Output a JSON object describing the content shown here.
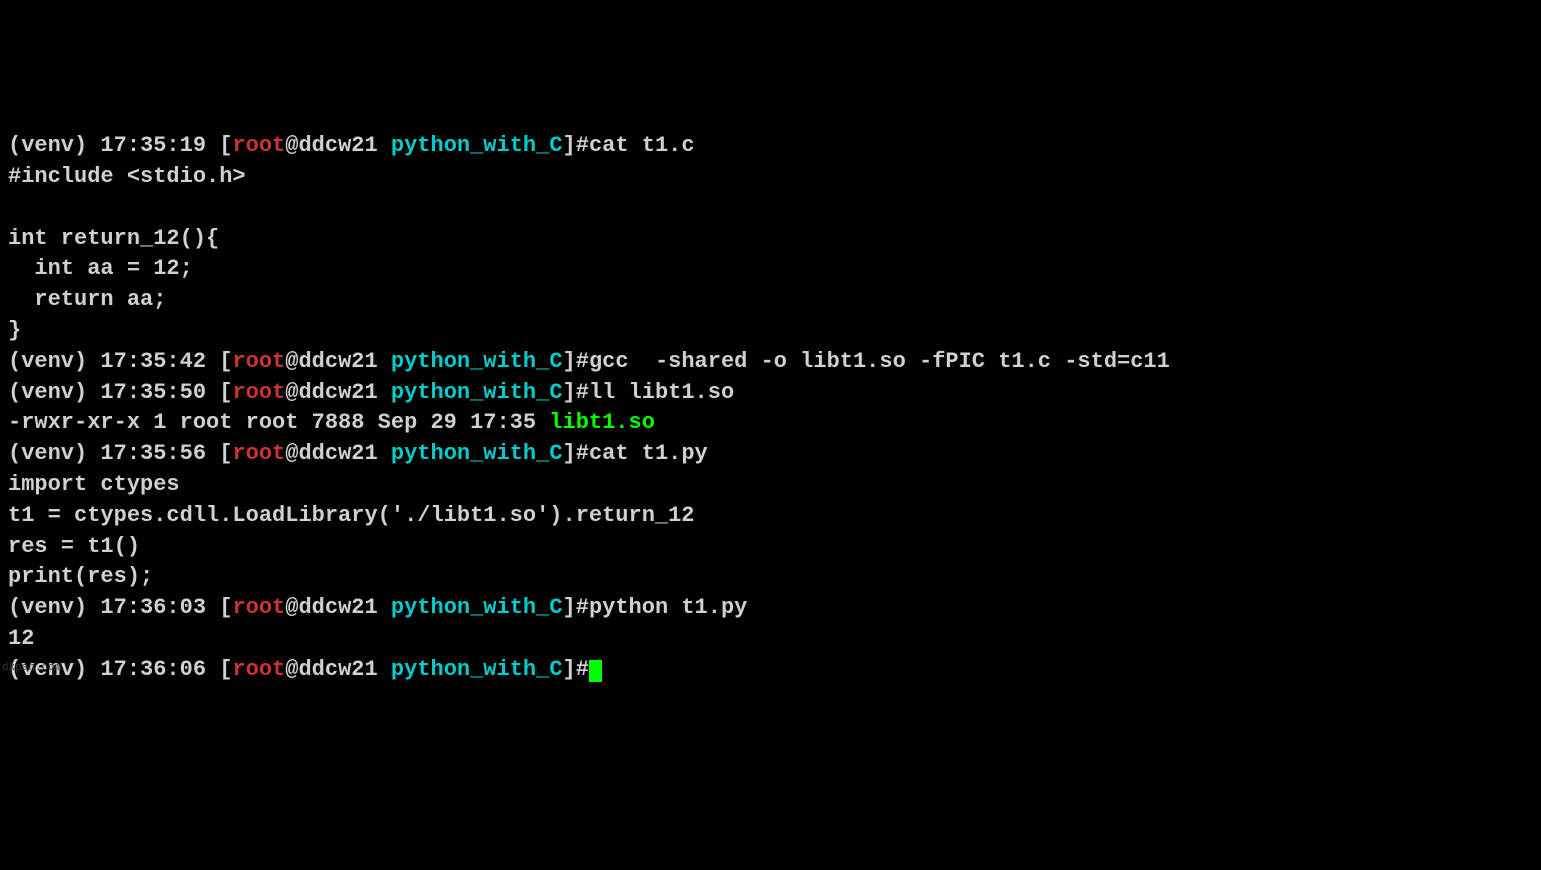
{
  "lines": [
    {
      "type": "prompt",
      "venv": "(venv)",
      "time": "17:35:19",
      "user": "root",
      "host": "ddcw21",
      "cwd": "python_with_C",
      "command": "cat t1.c"
    },
    {
      "type": "output",
      "text": "#include <stdio.h>"
    },
    {
      "type": "output",
      "text": ""
    },
    {
      "type": "output",
      "text": "int return_12(){"
    },
    {
      "type": "output",
      "text": "  int aa = 12;"
    },
    {
      "type": "output",
      "text": "  return aa;"
    },
    {
      "type": "output",
      "text": "}"
    },
    {
      "type": "prompt",
      "venv": "(venv)",
      "time": "17:35:42",
      "user": "root",
      "host": "ddcw21",
      "cwd": "python_with_C",
      "command": "gcc  -shared -o libt1.so -fPIC t1.c -std=c11"
    },
    {
      "type": "prompt",
      "venv": "(venv)",
      "time": "17:35:50",
      "user": "root",
      "host": "ddcw21",
      "cwd": "python_with_C",
      "command": "ll libt1.so"
    },
    {
      "type": "ls-output",
      "perms": "-rwxr-xr-x 1 root root 7888 Sep 29 17:35 ",
      "filename": "libt1.so"
    },
    {
      "type": "prompt",
      "venv": "(venv)",
      "time": "17:35:56",
      "user": "root",
      "host": "ddcw21",
      "cwd": "python_with_C",
      "command": "cat t1.py"
    },
    {
      "type": "output",
      "text": "import ctypes"
    },
    {
      "type": "output",
      "text": "t1 = ctypes.cdll.LoadLibrary('./libt1.so').return_12"
    },
    {
      "type": "output",
      "text": "res = t1()"
    },
    {
      "type": "output",
      "text": "print(res);"
    },
    {
      "type": "prompt",
      "venv": "(venv)",
      "time": "17:36:03",
      "user": "root",
      "host": "ddcw21",
      "cwd": "python_with_C",
      "command": "python t1.py"
    },
    {
      "type": "output",
      "text": "12"
    },
    {
      "type": "prompt-cursor",
      "venv": "(venv)",
      "time": "17:36:06",
      "user": "root",
      "host": "ddcw21",
      "cwd": "python_with_C",
      "command": ""
    }
  ],
  "watermark": "dkpan.com"
}
